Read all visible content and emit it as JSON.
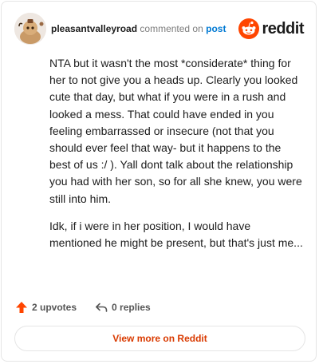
{
  "comment": {
    "username": "pleasantvalleyroad",
    "action_text": "commented on",
    "post_link": "post",
    "paragraphs": [
      "NTA but it wasn't the most *considerate* thing for her to not give you a heads up. Clearly you looked cute that day, but what if you were in a rush and looked a mess. That could have ended in you feeling embarrassed or insecure (not that you should ever feel that way- but it happens to the best of us :/ ). Yall dont talk about the relationship you had with her son, so for all she knew, you were still into him.",
      "Idk, if i were in her position, I would have mentioned he might be present, but that's just me..."
    ]
  },
  "brand": {
    "name": "reddit",
    "icon": "reddit-logo-icon",
    "color": "#ff4500"
  },
  "actions": {
    "upvotes_label": "2 upvotes",
    "upvote_icon": "upvote-arrow-icon",
    "upvote_color": "#ff4500",
    "replies_label": "0 replies",
    "reply_icon": "reply-arrow-icon"
  },
  "view_more": {
    "label": "View more on Reddit",
    "color": "#d93a00"
  }
}
